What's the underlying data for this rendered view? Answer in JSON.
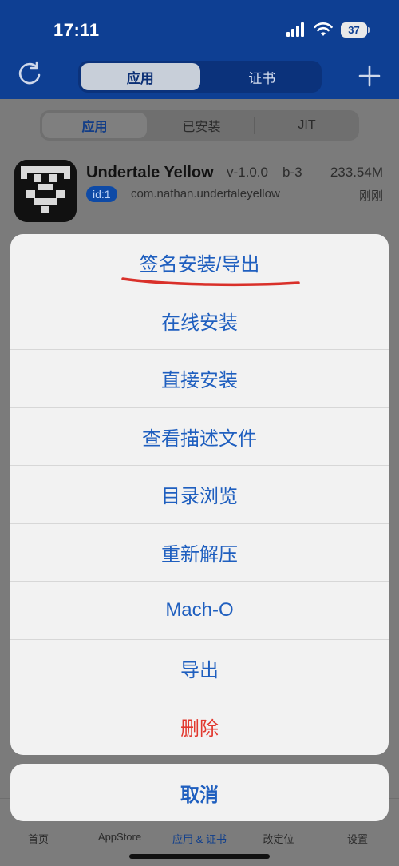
{
  "status_bar": {
    "time": "17:11",
    "battery": "37"
  },
  "header": {
    "segments": [
      {
        "label": "应用",
        "active": true
      },
      {
        "label": "证书",
        "active": false
      }
    ]
  },
  "filter_tabs": [
    {
      "label": "应用",
      "active": true
    },
    {
      "label": "已安装",
      "active": false
    },
    {
      "label": "JIT",
      "active": false
    }
  ],
  "app": {
    "name": "Undertale Yellow",
    "version": "v-1.0.0",
    "build": "b-3",
    "size": "233.54M",
    "id_badge": "id:1",
    "bundle_id": "com.nathan.undertaleyellow",
    "time_ago": "刚刚"
  },
  "action_sheet": {
    "options": [
      {
        "label": "签名安装/导出"
      },
      {
        "label": "在线安装"
      },
      {
        "label": "直接安装"
      },
      {
        "label": "查看描述文件"
      },
      {
        "label": "目录浏览"
      },
      {
        "label": "重新解压"
      },
      {
        "label": "Mach-O"
      },
      {
        "label": "导出"
      },
      {
        "label": "删除",
        "destructive": true
      }
    ],
    "cancel": "取消"
  },
  "tab_bar": {
    "items": [
      {
        "label": "首页"
      },
      {
        "label": "AppStore"
      },
      {
        "label": "应用 & 证书",
        "active": true
      },
      {
        "label": "改定位"
      },
      {
        "label": "设置"
      }
    ]
  },
  "colors": {
    "header_blue": "#0e3f93",
    "action_blue": "#1f5fbf",
    "destructive_red": "#e2382e",
    "annotation_red": "#d9302a"
  }
}
